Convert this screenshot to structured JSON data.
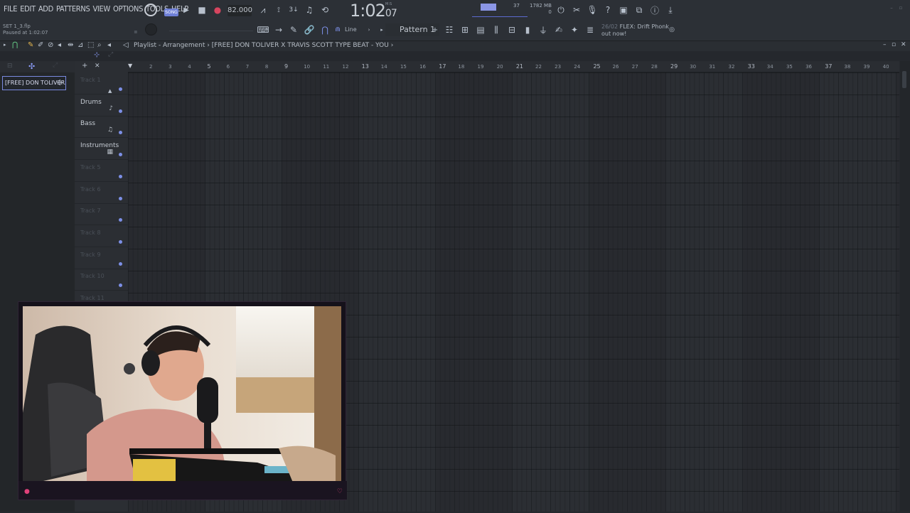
{
  "menu": [
    "FILE",
    "EDIT",
    "ADD",
    "PATTERNS",
    "VIEW",
    "OPTIONS",
    "TOOLS",
    "HELP"
  ],
  "transport": {
    "mode_label": "SONG",
    "tempo": "82.000",
    "time": "1:02",
    "time_sub": "07",
    "time_unit": "M:S"
  },
  "project_info": {
    "file": "SET 1_3.flp",
    "status": "Paused at 1:02:07"
  },
  "cpu": {
    "level": 0.6
  },
  "polyphony": "37",
  "memory": "1782 MB",
  "memory_sub": "0",
  "snap_mode": "Line",
  "pattern_selector": "Pattern 1",
  "news": {
    "date": "26/02",
    "line1": "FLEX: Drift Phonk",
    "line2": "out now!"
  },
  "playlist": {
    "breadcrumb": "Playlist - Arrangement",
    "separator": "›",
    "project_title": "[FREE] DON TOLIVER X TRAVIS SCOTT TYPE BEAT - YOU",
    "pattern_item": "[FREE] DON TOLIVER...",
    "tracks": [
      {
        "name": "Track 1",
        "active": false
      },
      {
        "name": "Drums",
        "active": true
      },
      {
        "name": "Bass",
        "active": true
      },
      {
        "name": "Instruments",
        "active": true
      },
      {
        "name": "Track 5",
        "active": false
      },
      {
        "name": "Track 6",
        "active": false
      },
      {
        "name": "Track 7",
        "active": false
      },
      {
        "name": "Track 8",
        "active": false
      },
      {
        "name": "Track 9",
        "active": false
      },
      {
        "name": "Track 10",
        "active": false
      },
      {
        "name": "Track 11",
        "active": false
      }
    ],
    "bars": [
      "2",
      "3",
      "4",
      "5",
      "6",
      "7",
      "8",
      "9",
      "10",
      "11",
      "12",
      "13",
      "14",
      "15",
      "16",
      "17",
      "18",
      "19",
      "20",
      "21",
      "22",
      "23",
      "24",
      "25",
      "26",
      "27",
      "28",
      "29",
      "30",
      "31",
      "32",
      "33",
      "34",
      "35",
      "36",
      "37",
      "38",
      "39",
      "40"
    ],
    "major_bars": [
      "5",
      "9",
      "13",
      "17",
      "21",
      "25",
      "29",
      "33",
      "37"
    ]
  },
  "colors": {
    "accent": "#7c8fe6",
    "background": "#25282d",
    "grid": "#2b2e33",
    "record": "#d6455f",
    "webcam_accent": "#e0417a"
  }
}
